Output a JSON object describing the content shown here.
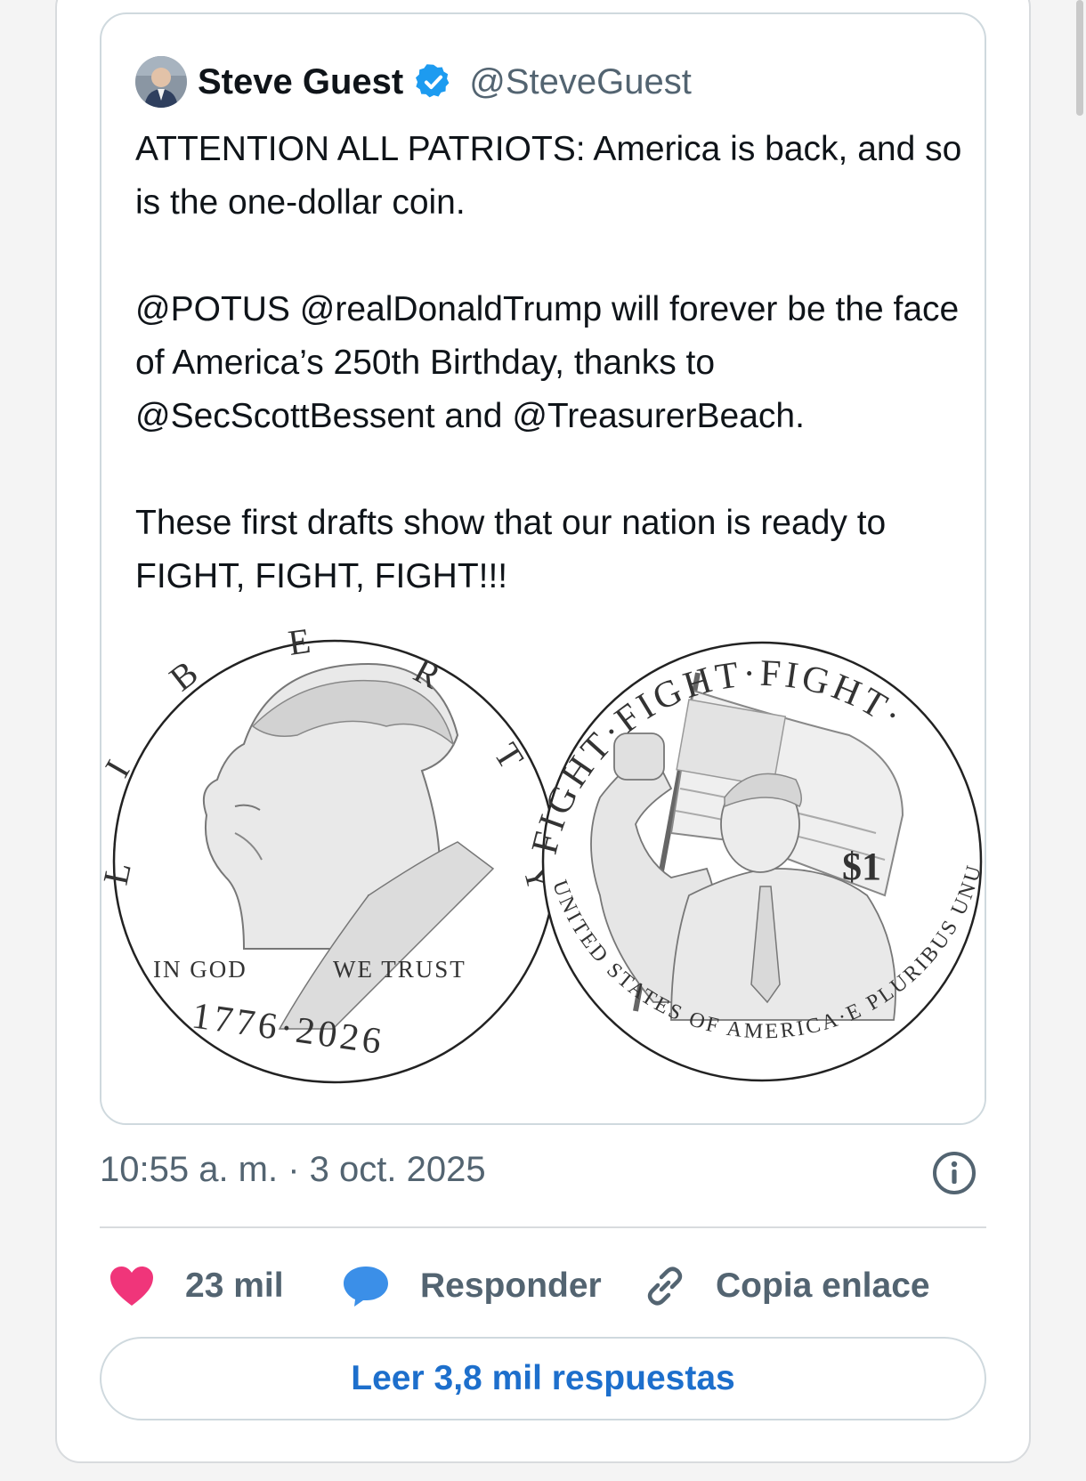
{
  "tweet": {
    "author_name": "Steve Guest",
    "author_handle": "@SteveGuest",
    "verified": true,
    "paragraphs": [
      "ATTENTION ALL PATRIOTS: America is back, and so is the one-dollar coin.",
      "@POTUS @realDonaldTrump will forever be the face of America’s 250th Birthday, thanks to @SecScottBessent and @TreasurerBeach.",
      "These first drafts show that our nation is ready to FIGHT, FIGHT, FIGHT!!!"
    ]
  },
  "media": {
    "obverse": {
      "liberty": [
        "L",
        "I",
        "B",
        "E",
        "R",
        "T",
        "Y"
      ],
      "motto_left": "IN GOD",
      "motto_right": "WE TRUST",
      "dates": "1776·2026"
    },
    "reverse": {
      "rim_top": "FIGHT·FIGHT·FIGHT·",
      "rim_bottom": "UNITED STATES OF AMERICA·E PLURIBUS UNUM",
      "denomination": "$1"
    }
  },
  "meta": {
    "timestamp": "10:55 a. m. · 3 oct. 2025"
  },
  "actions": {
    "likes_count": "23 mil",
    "reply_label": "Responder",
    "copy_link_label": "Copia enlace",
    "read_replies_label": "Leer 3,8 mil respuestas"
  },
  "icons": {
    "avatar": "avatar",
    "verified": "verified-badge-icon",
    "info": "info-icon",
    "like": "heart-icon",
    "reply": "speech-bubble-icon",
    "copy_link": "link-icon"
  },
  "colors": {
    "verified_blue": "#1d9bf0",
    "heart": "#f0357a",
    "reply_bubble": "#3b8fe8",
    "link_text": "#1d6fcc",
    "secondary_text": "#536471"
  }
}
